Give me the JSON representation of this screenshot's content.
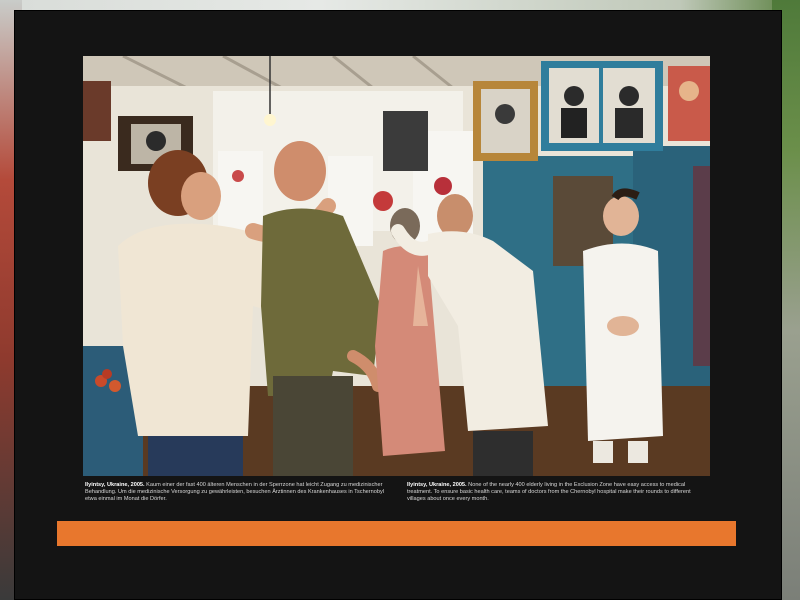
{
  "caption_de": {
    "place": "Ilyintsy, Ukraine, 2005.",
    "text": "Kaum einer der fast 400 älteren Menschen in der Sperrzone hat leicht Zugang zu medizinischer Behandlung. Um die medizinische Versorgung zu gewährleisten, besuchen Ärztinnen des Krankenhauses in Tschernobyl etwa einmal im Monat die Dörfer."
  },
  "caption_en": {
    "place": "Ilyintsy, Ukraine, 2005.",
    "text": "None of the nearly 400 elderly living in the Exclusion Zone have easy access to medical treatment. To ensure basic health care, teams of doctors from the Chernobyl hospital make their rounds to different villages about once every month."
  },
  "colors": {
    "board": "#141414",
    "accent_band": "#e8772d",
    "wall_blue": "#2f6f86"
  }
}
